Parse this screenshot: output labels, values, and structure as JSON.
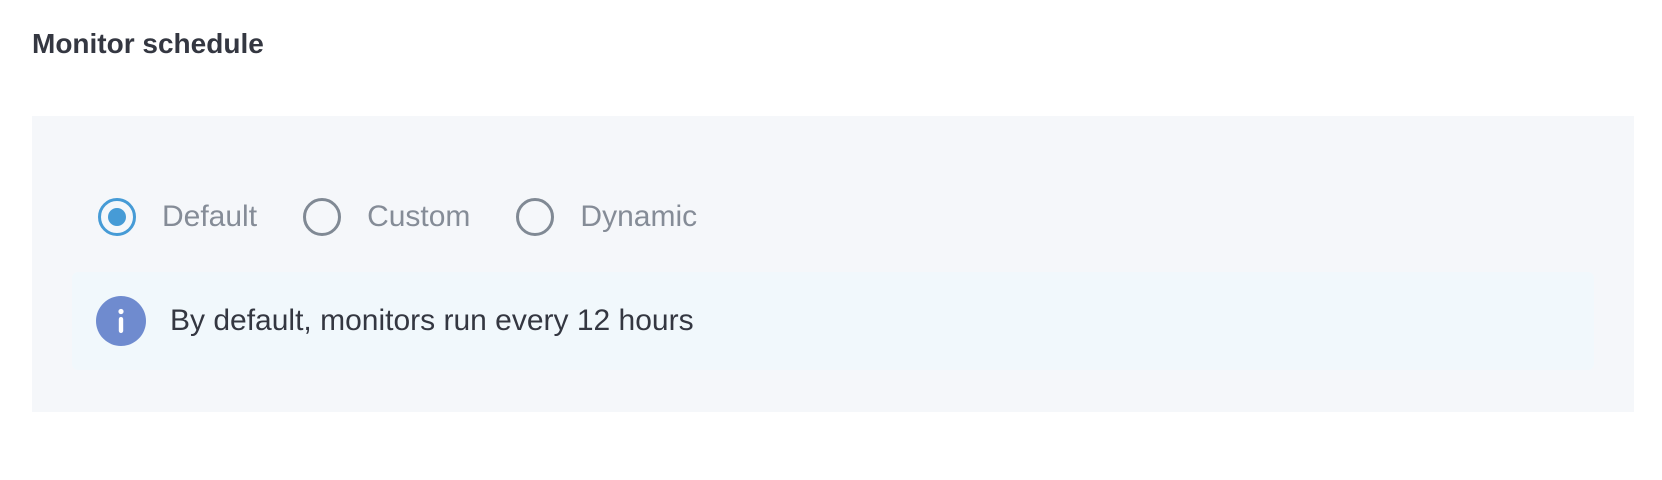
{
  "section": {
    "title": "Monitor schedule"
  },
  "schedule": {
    "options": [
      {
        "label": "Default",
        "selected": true
      },
      {
        "label": "Custom",
        "selected": false
      },
      {
        "label": "Dynamic",
        "selected": false
      }
    ]
  },
  "callout": {
    "icon": "info-icon",
    "text": "By default, monitors run every 12 hours"
  },
  "colors": {
    "accent": "#469bd6",
    "info_icon": "#6f8bcf",
    "panel_bg": "#f5f7fa",
    "callout_bg": "#f1f8fc",
    "title_text": "#343741",
    "muted_text": "#858c97"
  }
}
